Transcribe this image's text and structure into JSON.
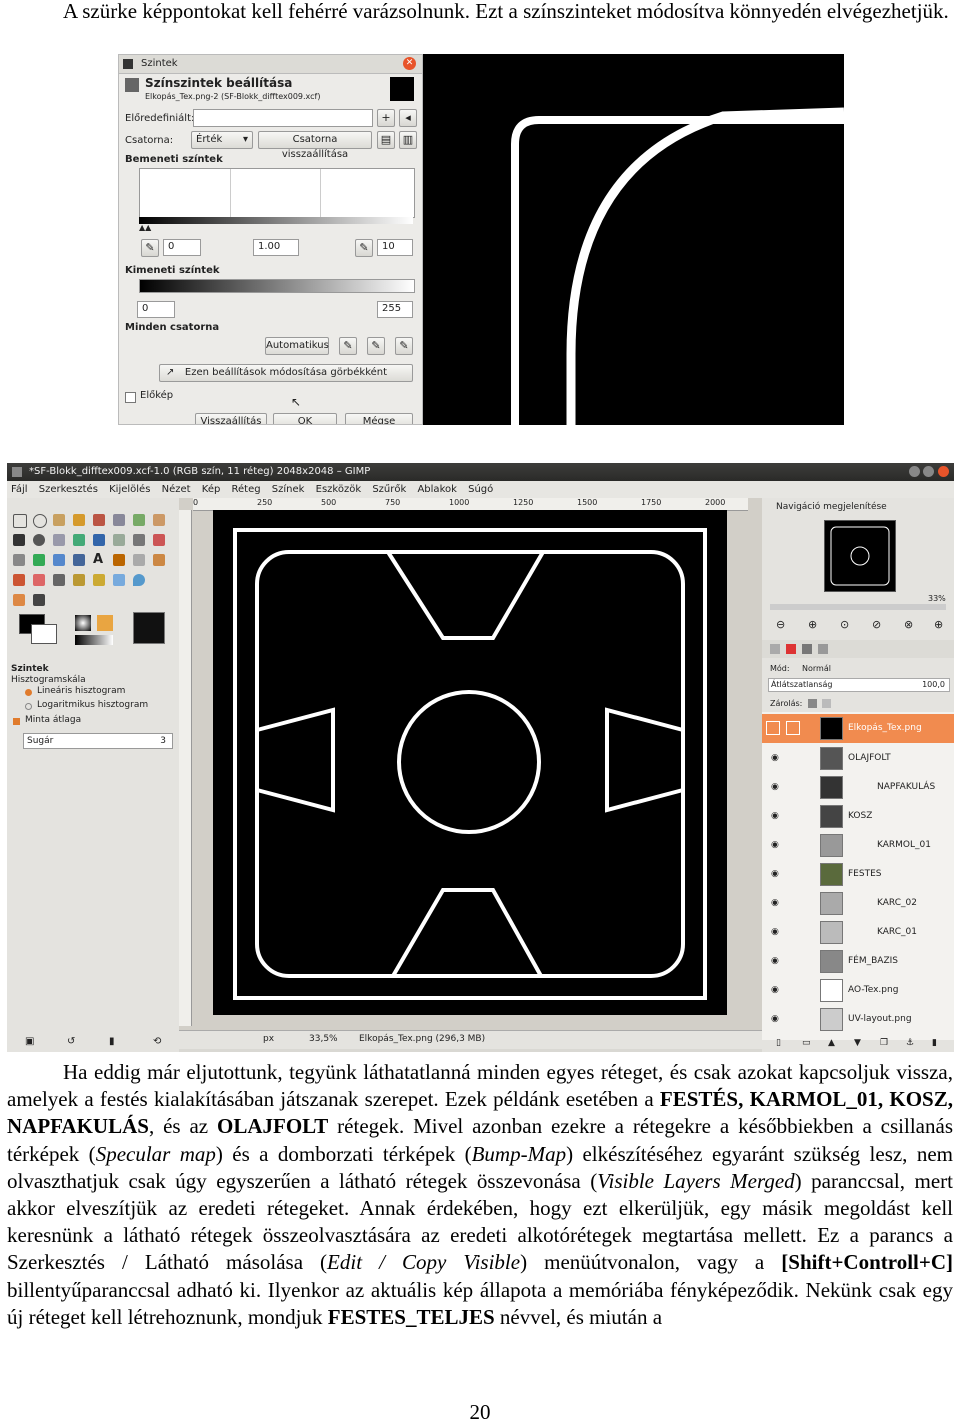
{
  "page": {
    "para1": "A szürke képpontokat kell fehérré varázsolnunk. Ezt a színszinteket módosítva könnyedén elvégezhetjük.",
    "page_number": "20"
  },
  "levels_dialog": {
    "window_title": "Szintek",
    "heading": "Színszintek beállítása",
    "subheading": "Elkopás_Tex.png-2 (SF-Blokk_difftex009.xcf)",
    "presets_label": "Előredefiniált:",
    "channel_label": "Csatorna:",
    "channel_value": "Érték",
    "reset_channel": "Csatorna visszaállítása",
    "input_levels": "Bemeneti színtek",
    "input_low": "0",
    "input_gamma": "1.00",
    "input_high": "10",
    "output_levels": "Kimeneti színtek",
    "output_low": "0",
    "output_high": "255",
    "all_channels": "Minden csatorna",
    "auto_button": "Automatikus",
    "curves_button": "Ezen beállítások módosítása görbékként",
    "preview_label": "Előkép",
    "reset_button": "Visszaállítás",
    "ok_button": "OK",
    "cancel_button": "Mégse"
  },
  "gimp": {
    "window_title": "*SF-Blokk_difftex009.xcf-1.0 (RGB szín, 11 réteg) 2048x2048 – GIMP",
    "menu": [
      "Fájl",
      "Szerkesztés",
      "Kijelölés",
      "Nézet",
      "Kép",
      "Réteg",
      "Színek",
      "Eszközök",
      "Szűrők",
      "Ablakok",
      "Súgó"
    ],
    "ruler_ticks": [
      "0",
      "250",
      "500",
      "750",
      "1000",
      "1250",
      "1500",
      "1750",
      "2000"
    ],
    "left_dock": {
      "title": "Szintek",
      "histogram_scale": "Hisztogramskála",
      "linear": "Lineáris hisztogram",
      "log": "Logaritmikus hisztogram",
      "sample_average": "Minta átlaga",
      "radius_label": "Sugár",
      "radius_value": "3"
    },
    "status": {
      "unit": "px",
      "zoom": "33,5%",
      "info": "Elkopás_Tex.png (296,3 MB)"
    },
    "right_dock": {
      "nav_title": "Navigáció megjelenítése",
      "nav_zoom": "33%",
      "mode_label": "Mód:",
      "mode_value": "Normál",
      "opacity_label": "Átlátszatlanság",
      "opacity_value": "100,0",
      "lock_label": "Zárolás:",
      "layers": [
        "Elkopás_Tex.png",
        "OLAJFOLT",
        "NAPFAKULÁS",
        "KOSZ",
        "KARMOL_01",
        "FESTES",
        "KARC_02",
        "KARC_01",
        "FÉM_BAZIS",
        "AO-Tex.png",
        "UV-layout.png"
      ]
    }
  },
  "body_text": {
    "p2_a": "Ha eddig már eljutottunk, tegyünk láthatatlanná minden egyes réteget, és csak azokat kapcsoljuk vissza, amelyek a festés kialakításában játszanak szerepet. Ezek példánk esetében a ",
    "p2_b": "FESTÉS, KARMOL_01, KOSZ, NAPFAKULÁS",
    "p2_c": ", és az ",
    "p2_d": "OLAJFOLT",
    "p2_e": " rétegek. Mivel azonban ezekre a rétegekre a későbbiekben a csillanás térképek (",
    "p2_f": "Specular map",
    "p2_g": ") és a domborzati térképek (",
    "p2_h": "Bump-Map",
    "p2_i": ") elkészítéséhez egyaránt szükség lesz, nem olvaszthatjuk csak úgy egyszerűen a látható rétegek összevonása (",
    "p2_j": "Visible Layers Merged",
    "p2_k": ") paranccsal, mert akkor elveszítjük az eredeti rétegeket. Annak érdekében, hogy ezt elkerüljük, egy másik megoldást kell keresnünk a látható rétegek összeolvasztására az eredeti alkotórétegek megtartása mellett. Ez a parancs a Szerkesztés / Látható másolása (",
    "p2_l": "Edit / Copy Visible",
    "p2_m": ") menüútvonalon, vagy a ",
    "p2_n": "[Shift+Controll+C]",
    "p2_o": " billentyűparanccsal adható ki. Ilyenkor az aktuális kép állapota a memóriába fényképeződik. Nekünk csak egy új réteget kell létrehoznunk, mondjuk ",
    "p2_p": "FESTES_TELJES",
    "p2_q": " névvel, és miután a"
  }
}
